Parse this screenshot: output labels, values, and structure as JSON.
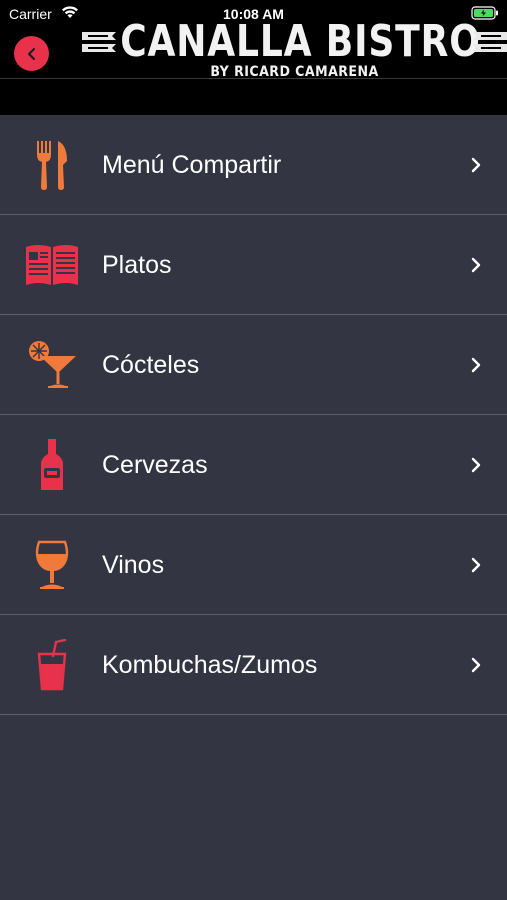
{
  "status_bar": {
    "carrier": "Carrier",
    "time": "10:08 AM"
  },
  "header": {
    "title": "CANALLA BISTRO",
    "subtitle": "BY RICARD CAMARENA",
    "back_icon": "chevron-left-icon"
  },
  "colors": {
    "accent_red": "#e8324b",
    "accent_orange": "#f07a3c",
    "background": "#333642",
    "header": "#000000"
  },
  "menu": {
    "items": [
      {
        "label": "Menú Compartir",
        "icon": "cutlery-icon"
      },
      {
        "label": "Platos",
        "icon": "book-icon"
      },
      {
        "label": "Cócteles",
        "icon": "cocktail-icon"
      },
      {
        "label": "Cervezas",
        "icon": "beer-bottle-icon"
      },
      {
        "label": "Vinos",
        "icon": "wine-glass-icon"
      },
      {
        "label": "Kombuchas/Zumos",
        "icon": "juice-glass-icon"
      }
    ]
  }
}
